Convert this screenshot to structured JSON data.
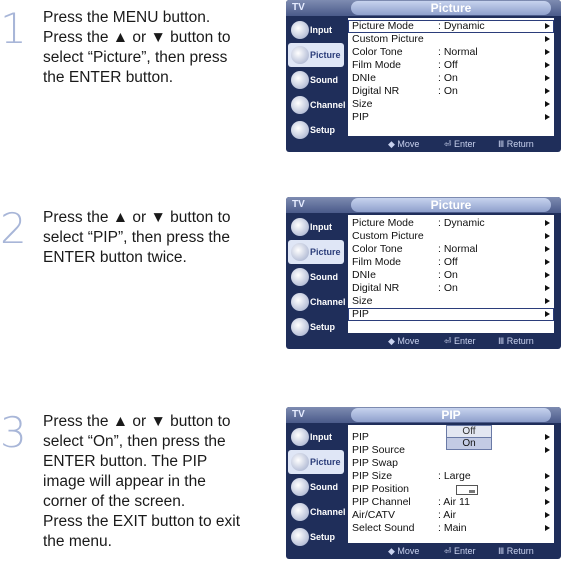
{
  "steps": [
    {
      "number": "1",
      "lines": [
        "Press the MENU button.",
        "Press the ▲ or ▼ button to",
        "select “Picture”, then press",
        "the ENTER button."
      ],
      "osd": {
        "tv_label": "TV",
        "title": "Picture",
        "sidebar": [
          {
            "label": "Input",
            "active": false
          },
          {
            "label": "Picture",
            "active": true
          },
          {
            "label": "Sound",
            "active": false
          },
          {
            "label": "Channel",
            "active": false
          },
          {
            "label": "Setup",
            "active": false
          }
        ],
        "rows": [
          {
            "key": "Picture Mode",
            "value": ": Dynamic",
            "selected": true
          },
          {
            "key": "Custom Picture",
            "value": "",
            "selected": false
          },
          {
            "key": "Color Tone",
            "value": ": Normal",
            "selected": false
          },
          {
            "key": "Film Mode",
            "value": ": Off",
            "selected": false
          },
          {
            "key": "DNIe",
            "value": ": On",
            "selected": false
          },
          {
            "key": "Digital NR",
            "value": ": On",
            "selected": false
          },
          {
            "key": "Size",
            "value": "",
            "selected": false
          },
          {
            "key": "PIP",
            "value": "",
            "selected": false
          }
        ],
        "footer": {
          "move": "◆ Move",
          "enter": "⏎ Enter",
          "return": "Ⅲ Return"
        }
      }
    },
    {
      "number": "2",
      "lines": [
        "Press the ▲ or ▼ button to",
        "select “PIP”, then press the",
        "ENTER button twice."
      ],
      "osd": {
        "tv_label": "TV",
        "title": "Picture",
        "sidebar": [
          {
            "label": "Input",
            "active": false
          },
          {
            "label": "Picture",
            "active": true
          },
          {
            "label": "Sound",
            "active": false
          },
          {
            "label": "Channel",
            "active": false
          },
          {
            "label": "Setup",
            "active": false
          }
        ],
        "rows": [
          {
            "key": "Picture Mode",
            "value": ": Dynamic",
            "selected": false
          },
          {
            "key": "Custom Picture",
            "value": "",
            "selected": false
          },
          {
            "key": "Color Tone",
            "value": ": Normal",
            "selected": false
          },
          {
            "key": "Film Mode",
            "value": ": Off",
            "selected": false
          },
          {
            "key": "DNIe",
            "value": ": On",
            "selected": false
          },
          {
            "key": "Digital NR",
            "value": ": On",
            "selected": false
          },
          {
            "key": "Size",
            "value": "",
            "selected": false
          },
          {
            "key": "PIP",
            "value": "",
            "selected": true
          }
        ],
        "footer": {
          "move": "◆ Move",
          "enter": "⏎ Enter",
          "return": "Ⅲ Return"
        }
      }
    },
    {
      "number": "3",
      "lines": [
        "Press the ▲ or ▼ button to",
        "select “On”, then press the",
        "ENTER button. The PIP",
        "image will appear in the",
        "corner of the screen.",
        "Press the EXIT button to exit",
        "the menu."
      ],
      "osd": {
        "tv_label": "TV",
        "title": "PIP",
        "sidebar": [
          {
            "label": "Input",
            "active": false
          },
          {
            "label": "Picture",
            "active": true
          },
          {
            "label": "Sound",
            "active": false
          },
          {
            "label": "Channel",
            "active": false
          },
          {
            "label": "Setup",
            "active": false
          }
        ],
        "rows": [
          {
            "key": "PIP",
            "value": "",
            "selected": false
          },
          {
            "key": "PIP Source",
            "value": "",
            "selected": false
          },
          {
            "key": "PIP Swap",
            "value": "",
            "selected": false
          },
          {
            "key": "PIP Size",
            "value": ": Large",
            "selected": false
          },
          {
            "key": "PIP Position",
            "value": "",
            "selected": false
          },
          {
            "key": "PIP Channel",
            "value": ": Air 11",
            "selected": false
          },
          {
            "key": "Air/CATV",
            "value": ": Air",
            "selected": false
          },
          {
            "key": "Select Sound",
            "value": ": Main",
            "selected": false
          }
        ],
        "pip_options": [
          "Off",
          "On"
        ],
        "footer": {
          "move": "◆ Move",
          "enter": "⏎ Enter",
          "return": "Ⅲ Return"
        }
      }
    }
  ]
}
